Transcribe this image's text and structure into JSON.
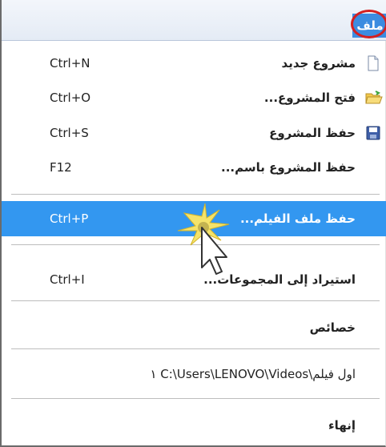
{
  "menubar": {
    "file_label": "ملف"
  },
  "menu": {
    "new_project": {
      "label": "مشروع جديد",
      "shortcut": "Ctrl+N",
      "icon": "new-document-icon"
    },
    "open_project": {
      "label": "فتح المشروع...",
      "shortcut": "Ctrl+O",
      "icon": "open-folder-icon"
    },
    "save_project": {
      "label": "حفظ المشروع",
      "shortcut": "Ctrl+S",
      "icon": "save-disk-icon"
    },
    "save_project_as": {
      "label": "حفظ المشروع باسم...",
      "shortcut": "F12"
    },
    "save_movie_file": {
      "label": "حفظ ملف الفيلم...",
      "shortcut": "Ctrl+P"
    },
    "import_collections": {
      "label": "استيراد إلى المجموعات...",
      "shortcut": "Ctrl+I"
    },
    "properties": {
      "label": "خصائص"
    },
    "recent_file": {
      "label": "١ C:\\Users\\LENOVO\\Videos\\اول فيلم"
    },
    "exit": {
      "label": "إنهاء"
    }
  },
  "colors": {
    "highlight": "#3397f0",
    "menubar_accent": "#3c8ce0",
    "annotation_circle": "#d42020"
  }
}
